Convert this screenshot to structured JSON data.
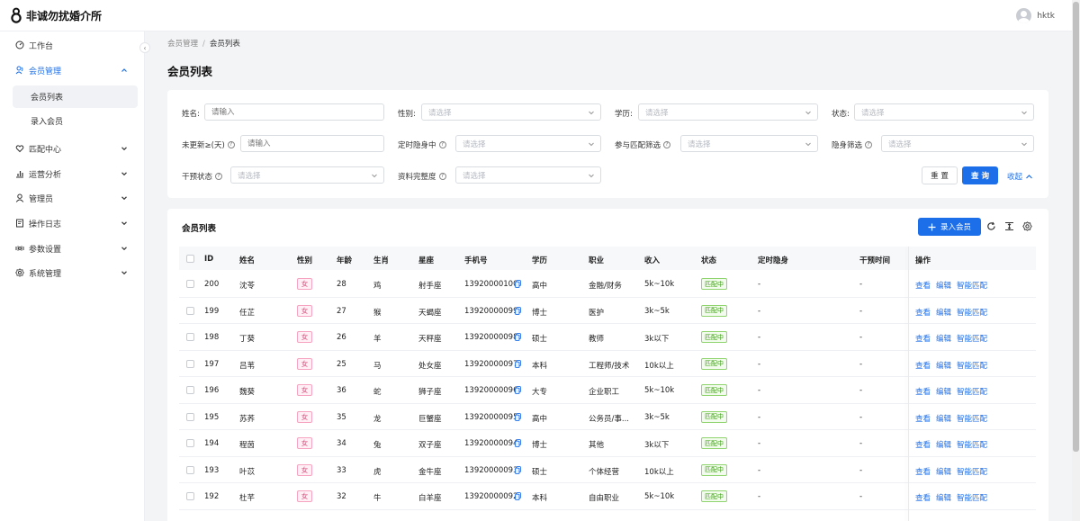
{
  "app": {
    "title": "非诚勿扰婚介所",
    "user": "hktk"
  },
  "sidebar": {
    "items": [
      {
        "label": "工作台",
        "icon": "dashboard-icon"
      },
      {
        "label": "会员管理",
        "icon": "member-icon",
        "open": true
      },
      {
        "label": "匹配中心",
        "icon": "heart-icon"
      },
      {
        "label": "运营分析",
        "icon": "chart-icon"
      },
      {
        "label": "管理员",
        "icon": "user-icon"
      },
      {
        "label": "操作日志",
        "icon": "log-icon"
      },
      {
        "label": "参数设置",
        "icon": "param-icon"
      },
      {
        "label": "系统管理",
        "icon": "gear-icon"
      }
    ],
    "sub": [
      {
        "label": "会员列表",
        "active": true
      },
      {
        "label": "录入会员"
      }
    ]
  },
  "breadcrumb": {
    "parent": "会员管理",
    "sep": "/",
    "current": "会员列表"
  },
  "page_title": "会员列表",
  "filters": {
    "name_label": "姓名:",
    "name_ph": "请输入",
    "gender_label": "性别:",
    "gender_ph": "请选择",
    "edu_label": "学历:",
    "edu_ph": "请选择",
    "status_label": "状态:",
    "status_ph": "请选择",
    "stale_label": "未更新≥(天)",
    "stale_ph": "请输入",
    "hidden_timer_label": "定时隐身中",
    "hidden_timer_ph": "请选择",
    "match_label": "参与匹配筛选",
    "match_ph": "请选择",
    "hidden_label": "隐身筛选",
    "hidden_ph": "请选择",
    "intervene_label": "干预状态",
    "intervene_ph": "请选择",
    "complete_label": "资料完整度",
    "complete_ph": "请选择",
    "reset": "重 置",
    "query": "查 询",
    "collapse": "收起"
  },
  "table": {
    "title": "会员列表",
    "add_button": "录入会员",
    "columns": [
      "ID",
      "姓名",
      "性别",
      "年龄",
      "生肖",
      "星座",
      "手机号",
      "学历",
      "职业",
      "收入",
      "状态",
      "定时隐身",
      "干预时间",
      "操作"
    ],
    "actions": [
      "查看",
      "编辑",
      "智能匹配"
    ],
    "rows": [
      {
        "id": "200",
        "name": "沈苓",
        "sex": "女",
        "age": "28",
        "zodiac": "鸡",
        "star": "射手座",
        "phone": "13920000100",
        "edu": "高中",
        "job": "金融/财务",
        "income": "5k~10k",
        "status": "匹配中",
        "hidden": "-",
        "intervene": "-"
      },
      {
        "id": "199",
        "name": "任芷",
        "sex": "女",
        "age": "27",
        "zodiac": "猴",
        "star": "天蝎座",
        "phone": "13920000099",
        "edu": "博士",
        "job": "医护",
        "income": "3k~5k",
        "status": "匹配中",
        "hidden": "-",
        "intervene": "-"
      },
      {
        "id": "198",
        "name": "丁葵",
        "sex": "女",
        "age": "26",
        "zodiac": "羊",
        "star": "天秤座",
        "phone": "13920000098",
        "edu": "硕士",
        "job": "教师",
        "income": "3k以下",
        "status": "匹配中",
        "hidden": "-",
        "intervene": "-"
      },
      {
        "id": "197",
        "name": "吕苇",
        "sex": "女",
        "age": "25",
        "zodiac": "马",
        "star": "处女座",
        "phone": "13920000097",
        "edu": "本科",
        "job": "工程师/技术",
        "income": "10k以上",
        "status": "匹配中",
        "hidden": "-",
        "intervene": "-"
      },
      {
        "id": "196",
        "name": "魏葵",
        "sex": "女",
        "age": "36",
        "zodiac": "蛇",
        "star": "狮子座",
        "phone": "13920000096",
        "edu": "大专",
        "job": "企业职工",
        "income": "5k~10k",
        "status": "匹配中",
        "hidden": "-",
        "intervene": "-"
      },
      {
        "id": "195",
        "name": "苏荞",
        "sex": "女",
        "age": "35",
        "zodiac": "龙",
        "star": "巨蟹座",
        "phone": "13920000095",
        "edu": "高中",
        "job": "公务员/事...",
        "income": "3k~5k",
        "status": "匹配中",
        "hidden": "-",
        "intervene": "-"
      },
      {
        "id": "194",
        "name": "程茵",
        "sex": "女",
        "age": "34",
        "zodiac": "兔",
        "star": "双子座",
        "phone": "13920000094",
        "edu": "博士",
        "job": "其他",
        "income": "3k以下",
        "status": "匹配中",
        "hidden": "-",
        "intervene": "-"
      },
      {
        "id": "193",
        "name": "叶苡",
        "sex": "女",
        "age": "33",
        "zodiac": "虎",
        "star": "金牛座",
        "phone": "13920000093",
        "edu": "硕士",
        "job": "个体经营",
        "income": "10k以上",
        "status": "匹配中",
        "hidden": "-",
        "intervene": "-"
      },
      {
        "id": "192",
        "name": "杜芊",
        "sex": "女",
        "age": "32",
        "zodiac": "牛",
        "star": "白羊座",
        "phone": "13920000092",
        "edu": "本科",
        "job": "自由职业",
        "income": "5k~10k",
        "status": "匹配中",
        "hidden": "-",
        "intervene": "-"
      }
    ]
  },
  "colors": {
    "primary": "#1d6fe9",
    "tag_female": "#e0457b",
    "tag_status": "#389e0d"
  }
}
